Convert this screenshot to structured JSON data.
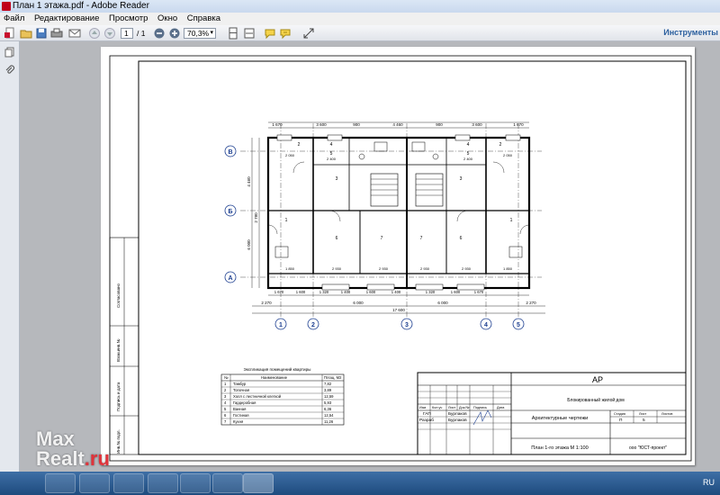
{
  "window": {
    "title": "План 1 этажа.pdf - Adobe Reader"
  },
  "menu": [
    "Файл",
    "Редактирование",
    "Просмотр",
    "Окно",
    "Справка"
  ],
  "toolbar": {
    "page_current": "1",
    "page_total": "/ 1",
    "zoom": "70,3%",
    "tools_label": "Инструменты"
  },
  "drawing": {
    "axes_rows": [
      "В",
      "Б",
      "А"
    ],
    "axes_cols": [
      "1",
      "2",
      "3",
      "4",
      "5"
    ],
    "room_numbers": [
      "1",
      "2",
      "3",
      "4",
      "5",
      "6",
      "7"
    ],
    "top_dims": [
      "1 670",
      "3 600",
      "900",
      "4 460",
      "900",
      "3 600",
      "1 670"
    ],
    "bottom_dims": [
      "2 270",
      "6 000",
      "17 600",
      "6 000",
      "2 270"
    ],
    "left_dims": [
      "4 460",
      "6 000",
      "2 780"
    ],
    "dim_labels": [
      "2 050",
      "2 400",
      "2 400",
      "2 050",
      "2 930",
      "2 930",
      "2 930",
      "2 930",
      "1 850",
      "1 850",
      "1 670",
      "1 600",
      "1 320",
      "1 400",
      "1 600",
      "1 400",
      "1 320",
      "1 600",
      "1 670"
    ]
  },
  "explication": {
    "title": "Экспликация помещений квартиры",
    "headers": [
      "№",
      "Наименование",
      "Площ. М2"
    ],
    "rows": [
      [
        "1",
        "Тамбур",
        "7,82"
      ],
      [
        "2",
        "Топочная",
        "3,89"
      ],
      [
        "3",
        "Холл с лестничной клеткой",
        "12,59"
      ],
      [
        "4",
        "Гардеробная",
        "5,93"
      ],
      [
        "5",
        "Ванная",
        "6,36"
      ],
      [
        "6",
        "Гостиная",
        "12,54"
      ],
      [
        "7",
        "Кухня",
        "11,26"
      ]
    ]
  },
  "stamp": {
    "code": "АР",
    "object": "Блокированный жилой дом",
    "section": "Архитектурные чертежи",
    "sheet_title": "План 1-го этажа М 1:100",
    "company": "ооо \"ЮСТ-проект\"",
    "col_headers": [
      "Изм",
      "Кол.уч",
      "Лист",
      "Док.№",
      "Подпись",
      "Дата"
    ],
    "stage_headers": [
      "Стадия",
      "Лист",
      "Листов"
    ],
    "stage_values": [
      "П",
      "5",
      ""
    ],
    "roles": [
      {
        "role": "ГАП",
        "name": "Бурлаков"
      },
      {
        "role": "Разраб",
        "name": "Бурлаков"
      }
    ]
  },
  "side_stamp": [
    "Согласовано",
    "Взам.инв.№",
    "Подпись и дата",
    "Инв.№ подл."
  ],
  "watermark": {
    "part1": "Max",
    "part2": "Realt",
    "part3": ".ru"
  },
  "taskbar": {
    "lang": "RU"
  }
}
